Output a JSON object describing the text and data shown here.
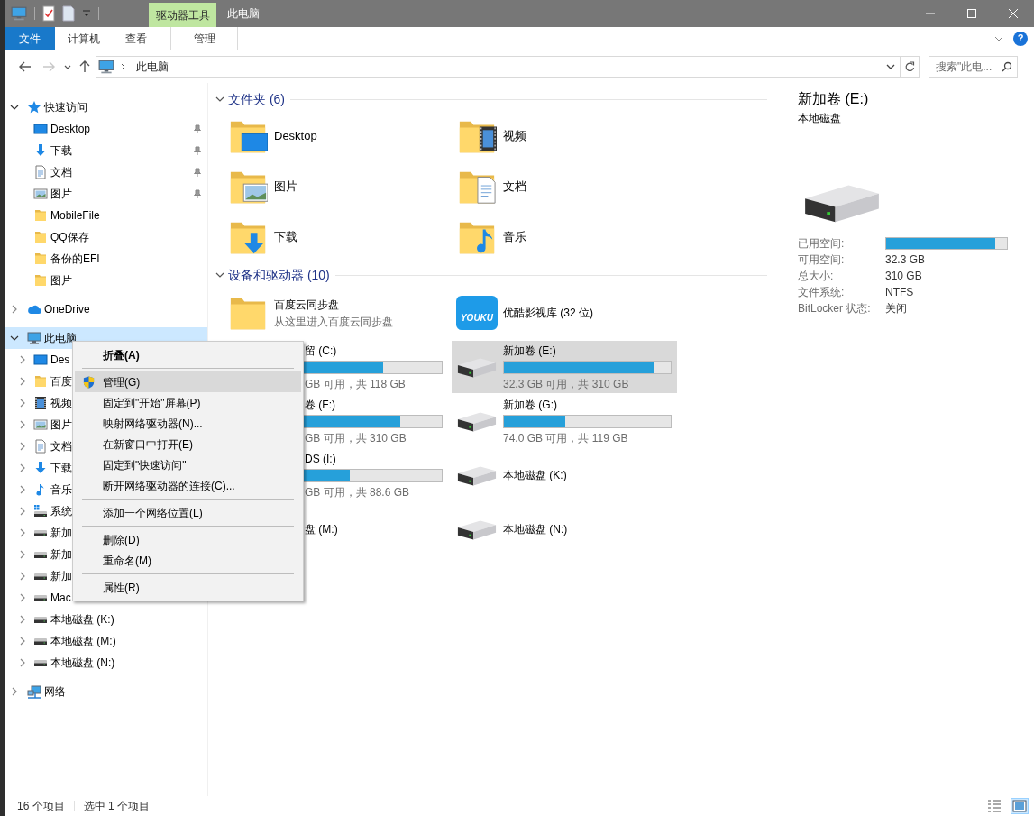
{
  "window": {
    "title": "此电脑",
    "contextual_group": "驱动器工具"
  },
  "ribbon": {
    "tabs": [
      {
        "label": "文件",
        "kind": "file"
      },
      {
        "label": "计算机",
        "kind": "normal"
      },
      {
        "label": "查看",
        "kind": "normal"
      },
      {
        "label": "管理",
        "kind": "contextual"
      }
    ],
    "help_label": "?"
  },
  "navigation": {
    "buttons": [
      {
        "kind": "back",
        "disabled": false
      },
      {
        "kind": "forward",
        "disabled": true
      },
      {
        "kind": "recent",
        "disabled": false
      },
      {
        "kind": "up",
        "disabled": false
      }
    ],
    "path": [
      "此电脑"
    ],
    "search": {
      "placeholder": "搜索\"此电..."
    }
  },
  "sidebar": {
    "tree": [
      {
        "label": "快速访问",
        "kind": "star",
        "expanded": true,
        "selected": false,
        "children": [
          {
            "label": "Desktop",
            "kind": "desktop",
            "pinned": true,
            "selected": false
          },
          {
            "label": "下载",
            "kind": "download",
            "pinned": true,
            "selected": false
          },
          {
            "label": "文档",
            "kind": "document",
            "pinned": true,
            "selected": false
          },
          {
            "label": "图片",
            "kind": "picture",
            "pinned": true,
            "selected": false
          },
          {
            "label": "MobileFile",
            "kind": "folder",
            "pinned": false,
            "selected": false
          },
          {
            "label": "QQ保存",
            "kind": "folder",
            "pinned": false,
            "selected": false
          },
          {
            "label": "备份的EFI",
            "kind": "folder",
            "pinned": false,
            "selected": false
          },
          {
            "label": "图片",
            "kind": "folder",
            "pinned": false,
            "selected": false
          }
        ]
      },
      {
        "label": "OneDrive",
        "kind": "cloud",
        "expanded": false,
        "selected": false
      },
      {
        "label": "此电脑",
        "kind": "pc",
        "expanded": true,
        "selected": true,
        "children": [
          {
            "label": "Des",
            "kind": "desktop",
            "expanded": false,
            "selected": false
          },
          {
            "label": "百度",
            "kind": "folder",
            "expanded": false,
            "selected": false
          },
          {
            "label": "视频",
            "kind": "video",
            "expanded": false,
            "selected": false
          },
          {
            "label": "图片",
            "kind": "picture",
            "expanded": false,
            "selected": false
          },
          {
            "label": "文档",
            "kind": "document",
            "expanded": false,
            "selected": false
          },
          {
            "label": "下载",
            "kind": "download",
            "expanded": false,
            "selected": false
          },
          {
            "label": "音乐",
            "kind": "music",
            "expanded": false,
            "selected": false
          },
          {
            "label": "系统",
            "kind": "system-drive",
            "expanded": false,
            "selected": false
          },
          {
            "label": "新加",
            "kind": "drive",
            "expanded": false,
            "selected": false
          },
          {
            "label": "新加",
            "kind": "drive",
            "expanded": false,
            "selected": false
          },
          {
            "label": "新加",
            "kind": "drive",
            "expanded": false,
            "selected": false
          },
          {
            "label": "Mac",
            "kind": "drive",
            "expanded": false,
            "selected": false
          },
          {
            "label": "本地磁盘 (K:)",
            "kind": "drive",
            "expanded": false,
            "selected": false
          },
          {
            "label": "本地磁盘 (M:)",
            "kind": "drive",
            "expanded": false,
            "selected": false
          },
          {
            "label": "本地磁盘 (N:)",
            "kind": "drive",
            "expanded": false,
            "selected": false
          }
        ]
      },
      {
        "label": "网络",
        "kind": "network",
        "expanded": false,
        "selected": false
      }
    ]
  },
  "folders": {
    "header": "文件夹 (6)",
    "expanded": true,
    "items": [
      {
        "label": "Desktop",
        "kind": "desktop"
      },
      {
        "label": "视频",
        "kind": "video"
      },
      {
        "label": "图片",
        "kind": "picture"
      },
      {
        "label": "文档",
        "kind": "document"
      },
      {
        "label": "下载",
        "kind": "download"
      },
      {
        "label": "音乐",
        "kind": "music"
      }
    ]
  },
  "devices": {
    "header": "设备和驱动器 (10)",
    "expanded": true,
    "items": [
      {
        "kind": "folder",
        "name": "百度云同步盘",
        "subtitle": "从这里进入百度云同步盘",
        "selected": false
      },
      {
        "kind": "app",
        "name": "优酷影视库 (32 位)",
        "logo_text": "YOUKU",
        "selected": false
      },
      {
        "kind": "covered",
        "name": "留 (C:)",
        "level": 0.65,
        "subtitle": "GB 可用，共 118 GB",
        "selected": false
      },
      {
        "kind": "drive",
        "name": "新加卷 (E:)",
        "level": 0.9,
        "subtitle": "32.3 GB 可用，共 310 GB",
        "selected": true
      },
      {
        "kind": "covered",
        "name": "卷 (F:)",
        "level": 0.75,
        "subtitle": "GB 可用，共 310 GB",
        "selected": false
      },
      {
        "kind": "drive",
        "name": "新加卷 (G:)",
        "level": 0.37,
        "subtitle": "74.0 GB 可用，共 119 GB",
        "selected": false
      },
      {
        "kind": "covered",
        "name": "DS (I:)",
        "level": 0.45,
        "subtitle": "GB 可用，共 88.6 GB",
        "selected": false
      },
      {
        "kind": "drive",
        "name": "本地磁盘 (K:)",
        "selected": false
      },
      {
        "kind": "covered",
        "name": "盘 (M:)",
        "selected": false
      },
      {
        "kind": "drive",
        "name": "本地磁盘 (N:)",
        "selected": false
      }
    ]
  },
  "details": {
    "title": "新加卷 (E:)",
    "subtitle": "本地磁盘",
    "properties": [
      {
        "label": "已用空间:",
        "level": 0.9
      },
      {
        "label": "可用空间:",
        "value": "32.3 GB"
      },
      {
        "label": "总大小:",
        "value": "310 GB"
      },
      {
        "label": "文件系统:",
        "value": "NTFS"
      },
      {
        "label": "BitLocker 状态:",
        "value": "关闭"
      }
    ]
  },
  "context_menu": {
    "items": [
      {
        "kind": "item",
        "label": "折叠(A)",
        "default": true,
        "selected": false
      },
      {
        "kind": "separator"
      },
      {
        "kind": "admin",
        "label": "管理(G)",
        "default": false,
        "selected": true
      },
      {
        "kind": "item",
        "label": "固定到\"开始\"屏幕(P)",
        "default": false,
        "selected": false
      },
      {
        "kind": "item",
        "label": "映射网络驱动器(N)...",
        "default": false,
        "selected": false
      },
      {
        "kind": "item",
        "label": "在新窗口中打开(E)",
        "default": false,
        "selected": false
      },
      {
        "kind": "item",
        "label": "固定到\"快速访问\"",
        "default": false,
        "selected": false
      },
      {
        "kind": "item",
        "label": "断开网络驱动器的连接(C)...",
        "default": false,
        "selected": false
      },
      {
        "kind": "separator"
      },
      {
        "kind": "item",
        "label": "添加一个网络位置(L)",
        "default": false,
        "selected": false
      },
      {
        "kind": "separator"
      },
      {
        "kind": "item",
        "label": "删除(D)",
        "default": false,
        "selected": false
      },
      {
        "kind": "item",
        "label": "重命名(M)",
        "default": false,
        "selected": false
      },
      {
        "kind": "separator"
      },
      {
        "kind": "item",
        "label": "属性(R)",
        "default": false,
        "selected": false
      }
    ]
  },
  "status_bar": {
    "texts": [
      "16 个项目",
      "选中 1 个项目"
    ],
    "views": [
      {
        "kind": "details",
        "selected": false
      },
      {
        "kind": "large-icons",
        "selected": true
      }
    ]
  }
}
